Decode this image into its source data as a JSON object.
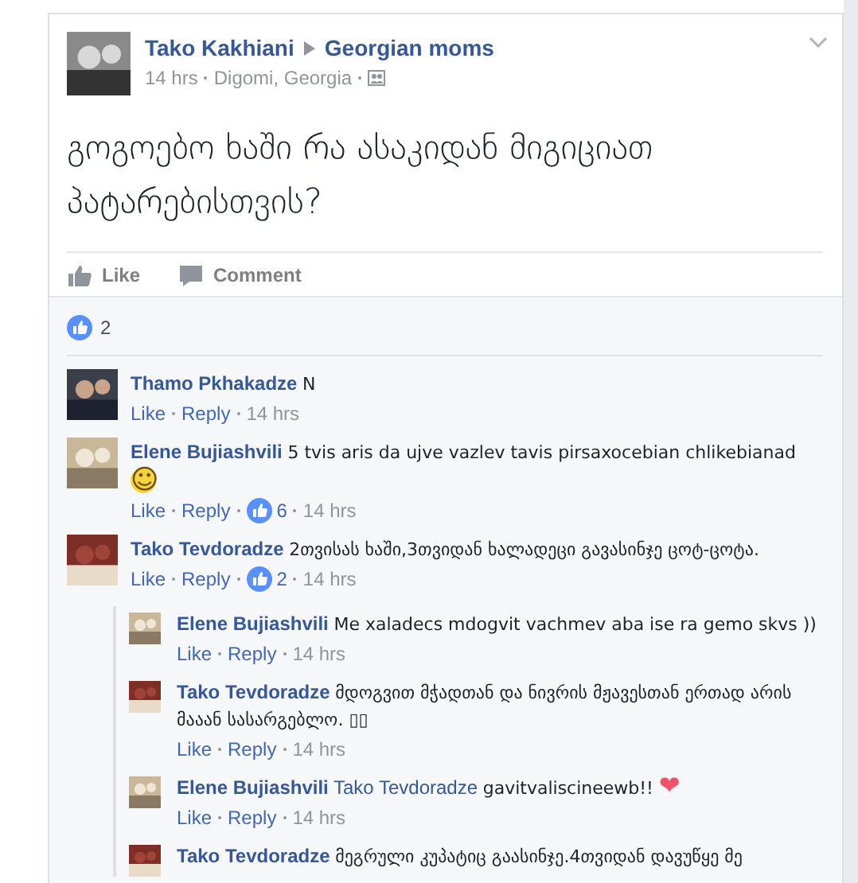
{
  "post": {
    "author": "Tako Kakhiani",
    "group": "Georgian moms",
    "time": "14 hrs",
    "location": "Digomi, Georgia",
    "text": "გოგოებო ხაში რა ასაკიდან მიგიციათ პატარებისთვის?",
    "actions": [
      {
        "label": "Like",
        "kind": "like"
      },
      {
        "label": "Comment",
        "kind": "comment"
      }
    ],
    "likes": "2"
  },
  "comments": [
    {
      "author": "Thamo Pkhakadze",
      "text": "N",
      "time": "14 hrs",
      "like": "Like",
      "reply": "Reply"
    },
    {
      "author": "Elene Bujiashvili",
      "text": "5 tvis aris da ujve vazlev tavis pirsaxocebian chlikebianad",
      "emoji": "☺",
      "likes": "6",
      "time": "14 hrs",
      "like": "Like",
      "reply": "Reply"
    },
    {
      "author": "Tako Tevdoradze",
      "text": "2თვისას ხაში,3თვიდან ხალადეცი გავასინჯე ცოტ-ცოტა.",
      "likes": "2",
      "time": "14 hrs",
      "like": "Like",
      "reply": "Reply",
      "children": [
        {
          "author": "Elene Bujiashvili",
          "text": "Me xaladecs mdogvit vachmev aba ise ra gemo skvs ))",
          "time": "14 hrs",
          "like": "Like",
          "reply": "Reply"
        },
        {
          "author": "Tako Tevdoradze",
          "text": "მდოგვით მჭადთან და ნივრის მჟავესთან ერთად არის მააან სასარგებლო. ▯▯",
          "time": "14 hrs",
          "like": "Like",
          "reply": "Reply"
        },
        {
          "author": "Elene Bujiashvili",
          "mention": "Tako Tevdoradze",
          "text": "gavitvaliscineewb!!",
          "emoji": "❤",
          "time": "14 hrs",
          "like": "Like",
          "reply": "Reply"
        },
        {
          "author": "Tako Tevdoradze",
          "text": "მეგრული კუპატიც გაასინჯე.4თვიდან დავუწყე მე"
        }
      ]
    }
  ]
}
